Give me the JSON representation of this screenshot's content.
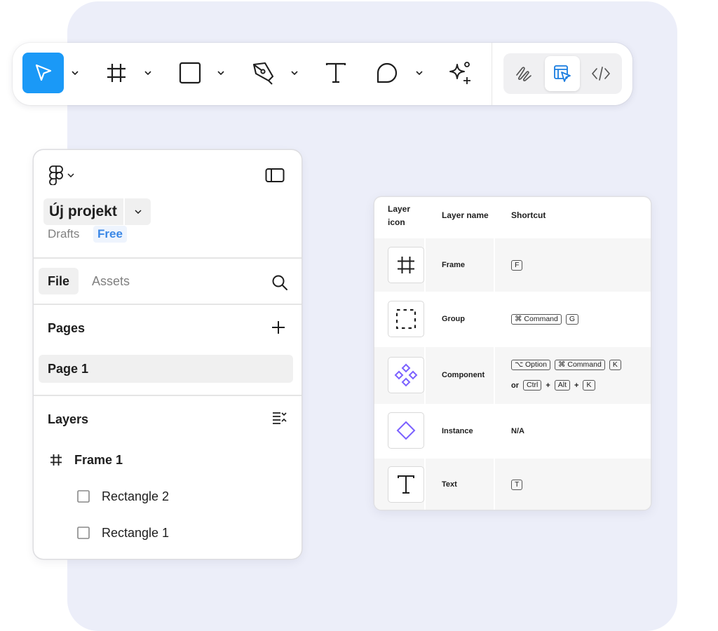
{
  "toolbar": {
    "tools": [
      {
        "name": "move-tool",
        "icon": "cursor-arrow-icon",
        "active": true
      },
      {
        "name": "frame-tool",
        "icon": "frame-hash-icon"
      },
      {
        "name": "shape-tool",
        "icon": "rectangle-icon"
      },
      {
        "name": "pen-tool",
        "icon": "pen-nib-icon"
      },
      {
        "name": "text-tool",
        "icon": "text-t-icon"
      },
      {
        "name": "comment-tool",
        "icon": "speech-bubble-icon"
      },
      {
        "name": "actions-tool",
        "icon": "sparkle-plus-icon"
      }
    ],
    "modes": [
      {
        "name": "draw-mode",
        "icon": "squiggle-icon"
      },
      {
        "name": "design-mode",
        "icon": "design-cursor-icon",
        "active": true
      },
      {
        "name": "dev-mode",
        "icon": "code-brackets-icon"
      }
    ],
    "accent_color": "#1a99f7"
  },
  "panel": {
    "logo_icon": "figma-logo-icon",
    "project_name": "Új projekt",
    "location": "Drafts",
    "plan_badge": "Free",
    "tabs": {
      "file": "File",
      "assets": "Assets"
    },
    "pages_title": "Pages",
    "pages": [
      "Page 1"
    ],
    "layers_title": "Layers",
    "layers": [
      {
        "name": "Frame 1",
        "icon": "frame-hash-icon",
        "depth": 0
      },
      {
        "name": "Rectangle 2",
        "icon": "rectangle-icon",
        "depth": 1
      },
      {
        "name": "Rectangle 1",
        "icon": "rectangle-icon",
        "depth": 1
      }
    ]
  },
  "table": {
    "headers": {
      "icon_line1": "Layer",
      "icon_line2": "icon",
      "name": "Layer name",
      "shortcut": "Shortcut"
    },
    "rows": [
      {
        "icon": "frame-hash-icon",
        "name": "Frame",
        "keys": [
          "F"
        ]
      },
      {
        "icon": "dashed-group-icon",
        "name": "Group",
        "keys": [
          "⌘ Command",
          "G"
        ]
      },
      {
        "icon": "component-diamonds-icon",
        "name": "Component",
        "keys": [
          "⌥ Option",
          "⌘ Command",
          "K"
        ],
        "alt_prefix": "or",
        "alt_keys": [
          "Ctrl",
          "Alt",
          "K"
        ],
        "plus": "+"
      },
      {
        "icon": "instance-diamond-icon",
        "name": "Instance",
        "text": "N/A"
      },
      {
        "icon": "text-t-icon",
        "name": "Text",
        "keys": [
          "T"
        ]
      }
    ],
    "component_color": "#7b61ff"
  }
}
